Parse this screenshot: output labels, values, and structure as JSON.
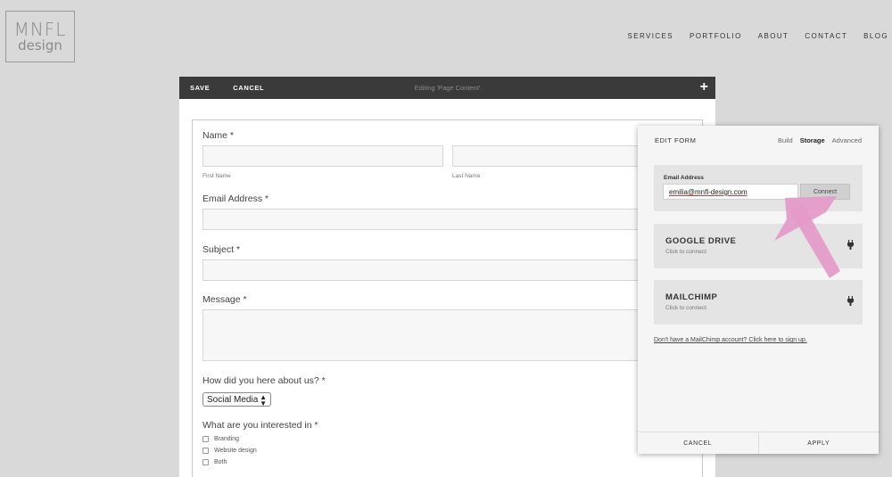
{
  "logo": {
    "line1": "MNFL",
    "line2": "design"
  },
  "nav": [
    "SERVICES",
    "PORTFOLIO",
    "ABOUT",
    "CONTACT",
    "BLOG"
  ],
  "editbar": {
    "save": "SAVE",
    "cancel": "CANCEL",
    "status": "Editing 'Page Content'",
    "add": "+"
  },
  "form": {
    "name_label": "Name *",
    "first_name": "First Name",
    "last_name": "Last Name",
    "email_label": "Email Address *",
    "subject_label": "Subject *",
    "message_label": "Message *",
    "how_label": "How did you here about us? *",
    "how_value": "Social Media",
    "interest_label": "What are you interested in *",
    "interests": [
      "Branding",
      "Website design",
      "Both"
    ]
  },
  "panel": {
    "title": "EDIT FORM",
    "tabs": [
      "Build",
      "Storage",
      "Advanced"
    ],
    "active_tab": "Storage",
    "email_label": "Email Address",
    "email_value": "emilia@mnfl-design.com",
    "connect": "Connect",
    "services": [
      {
        "name": "GOOGLE DRIVE",
        "sub": "Click to connect"
      },
      {
        "name": "MAILCHIMP",
        "sub": "Click to connect"
      }
    ],
    "signup": "Don't have a MailChimp account? Click here to sign up.",
    "cancel": "CANCEL",
    "apply": "APPLY"
  },
  "colors": {
    "arrow": "#e49bc8",
    "toolbar": "#3a3a3a",
    "background": "#d9d9d9"
  }
}
